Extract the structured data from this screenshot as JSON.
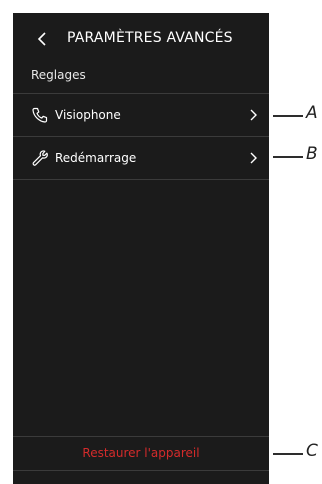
{
  "header": {
    "title": "PARAMÈTRES AVANCÉS",
    "back_icon": "chevron-left-icon"
  },
  "section": {
    "title": "Reglages"
  },
  "items": [
    {
      "label": "Visiophone",
      "icon": "phone-icon"
    },
    {
      "label": "Redémarrage",
      "icon": "wrench-icon"
    }
  ],
  "footer": {
    "restore_label": "Restaurer l'appareil",
    "restore_color": "#d42b2b"
  },
  "callouts": {
    "a": "A",
    "b": "B",
    "c": "C"
  },
  "colors": {
    "background": "#1b1b1b",
    "separator": "#3b3b3b",
    "text": "#ffffff"
  }
}
